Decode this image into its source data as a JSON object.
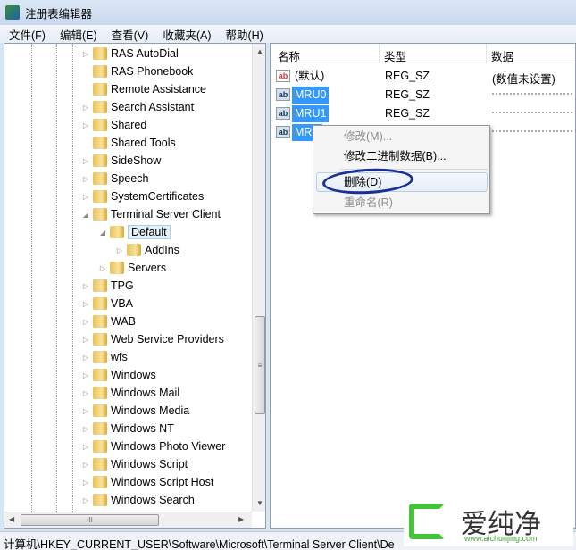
{
  "window": {
    "title": "注册表编辑器"
  },
  "menu": [
    "文件(F)",
    "编辑(E)",
    "查看(V)",
    "收藏夹(A)",
    "帮助(H)"
  ],
  "tree": {
    "items": [
      {
        "label": "RAS AutoDial",
        "level": 0,
        "expander": "collapsed"
      },
      {
        "label": "RAS Phonebook",
        "level": 0,
        "expander": "none"
      },
      {
        "label": "Remote Assistance",
        "level": 0,
        "expander": "none"
      },
      {
        "label": "Search Assistant",
        "level": 0,
        "expander": "collapsed"
      },
      {
        "label": "Shared",
        "level": 0,
        "expander": "collapsed"
      },
      {
        "label": "Shared Tools",
        "level": 0,
        "expander": "none"
      },
      {
        "label": "SideShow",
        "level": 0,
        "expander": "collapsed"
      },
      {
        "label": "Speech",
        "level": 0,
        "expander": "collapsed"
      },
      {
        "label": "SystemCertificates",
        "level": 0,
        "expander": "collapsed"
      },
      {
        "label": "Terminal Server Client",
        "level": 0,
        "expander": "expanded"
      },
      {
        "label": "Default",
        "level": 1,
        "expander": "expanded",
        "selected": true
      },
      {
        "label": "AddIns",
        "level": 2,
        "expander": "collapsed"
      },
      {
        "label": "Servers",
        "level": 1,
        "expander": "collapsed"
      },
      {
        "label": "TPG",
        "level": 0,
        "expander": "collapsed"
      },
      {
        "label": "VBA",
        "level": 0,
        "expander": "collapsed"
      },
      {
        "label": "WAB",
        "level": 0,
        "expander": "collapsed"
      },
      {
        "label": "Web Service Providers",
        "level": 0,
        "expander": "collapsed"
      },
      {
        "label": "wfs",
        "level": 0,
        "expander": "collapsed"
      },
      {
        "label": "Windows",
        "level": 0,
        "expander": "collapsed"
      },
      {
        "label": "Windows Mail",
        "level": 0,
        "expander": "collapsed"
      },
      {
        "label": "Windows Media",
        "level": 0,
        "expander": "collapsed"
      },
      {
        "label": "Windows NT",
        "level": 0,
        "expander": "collapsed"
      },
      {
        "label": "Windows Photo Viewer",
        "level": 0,
        "expander": "collapsed"
      },
      {
        "label": "Windows Script",
        "level": 0,
        "expander": "collapsed"
      },
      {
        "label": "Windows Script Host",
        "level": 0,
        "expander": "collapsed"
      },
      {
        "label": "Windows Search",
        "level": 0,
        "expander": "collapsed"
      }
    ]
  },
  "list": {
    "headers": [
      "名称",
      "类型",
      "数据"
    ],
    "rows": [
      {
        "name": "(默认)",
        "type": "REG_SZ",
        "data": "(数值未设置)",
        "selected": false
      },
      {
        "name": "MRU0",
        "type": "REG_SZ",
        "data": null,
        "selected": true
      },
      {
        "name": "MRU1",
        "type": "REG_SZ",
        "data": null,
        "selected": true
      },
      {
        "name": "MRU",
        "type": "",
        "data": null,
        "selected": true
      }
    ]
  },
  "context_menu": [
    {
      "label": "修改(M)...",
      "disabled": true
    },
    {
      "label": "修改二进制数据(B)...",
      "disabled": false
    },
    {
      "label": "删除(D)",
      "disabled": false,
      "highlighted": true
    },
    {
      "label": "重命名(R)",
      "disabled": true
    }
  ],
  "status": "计算机\\HKEY_CURRENT_USER\\Software\\Microsoft\\Terminal Server Client\\De",
  "watermark": {
    "text": "爱纯净",
    "url": "www.aichunjing.com"
  }
}
